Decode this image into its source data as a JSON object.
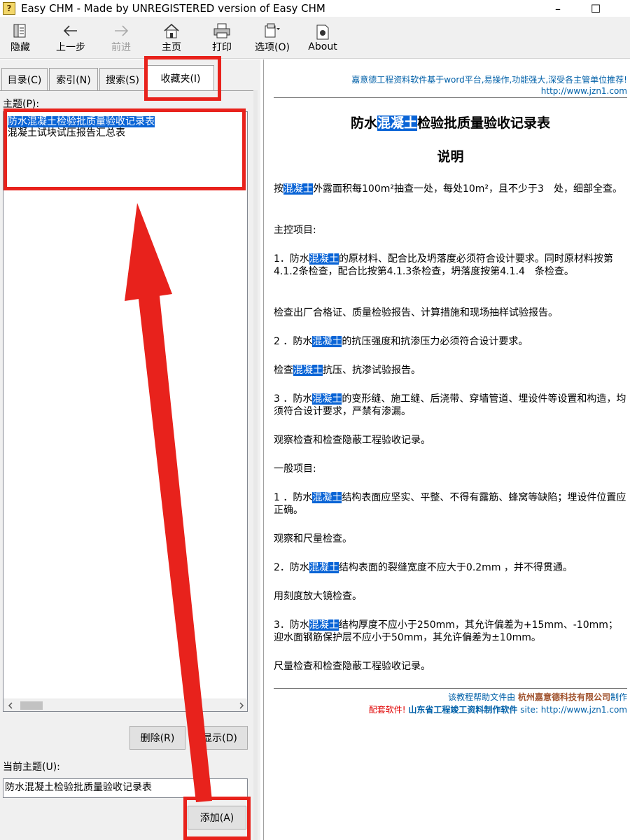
{
  "window": {
    "title": "Easy CHM - Made by UNREGISTERED version of Easy CHM",
    "icon_label": "?",
    "minimize": "–",
    "maximize": "☐"
  },
  "toolbar": {
    "items": [
      {
        "label": "隐藏",
        "icon": "hide-icon"
      },
      {
        "label": "上一步",
        "icon": "back-arrow-icon"
      },
      {
        "label": "前进",
        "icon": "forward-arrow-icon",
        "disabled": true
      },
      {
        "label": "主页",
        "icon": "home-icon"
      },
      {
        "label": "打印",
        "icon": "printer-icon"
      },
      {
        "label": "选项(O)",
        "icon": "options-icon"
      },
      {
        "label": "About",
        "icon": "about-icon"
      }
    ]
  },
  "tabs": [
    "目录(C)",
    "索引(N)",
    "搜索(S)",
    "收藏夹(I)"
  ],
  "favorites": {
    "topic_label": "主题(P):",
    "topics": [
      "防水混凝土检验批质量验收记录表",
      "混凝土试块试压报告汇总表"
    ],
    "delete_button": "删除(R)",
    "show_button": "显示(D)",
    "current_topic_label": "当前主题(U):",
    "current_topic_value": "防水混凝土检验批质量验收记录表",
    "add_button": "添加(A)"
  },
  "document": {
    "header_line1": "嘉意德工程资料软件基于word平台,易操作,功能强大,深受各主管单位推荐!",
    "header_line2": "http://www.jzn1.com",
    "title_pre": "防水",
    "title_hl": "混凝土",
    "title_post": "检验批质量验收记录表",
    "subtitle": "说明",
    "highlight": "混凝土",
    "p1_pre": "按",
    "p1_post": "外露面积每100m²抽查一处，每处10m²，且不少于3　处，细部全查。",
    "p2": "主控项目:",
    "p3_pre": "1．防水",
    "p3_post": "的原材料、配合比及坍落度必须符合设计要求。同时原材料按第4.1.2条检查，配合比按第4.1.3条检查，坍落度按第4.1.4　条检查。",
    "p4": "检查出厂合格证、质量检验报告、计算措施和现场抽样试验报告。",
    "p5_pre": "2 ．防水",
    "p5_post": "的抗压强度和抗渗压力必须符合设计要求。",
    "p6_pre": "检查",
    "p6_post": "抗压、抗渗试验报告。",
    "p7_pre": "3 ．防水",
    "p7_post": "的变形缝、施工缝、后浇带、穿墙管道、埋设件等设置和构造，均须符合设计要求，严禁有渗漏。",
    "p8": "观察检查和检查隐蔽工程验收记录。",
    "p9": "一般项目:",
    "p10_pre": "1 ．防水",
    "p10_post": "结构表面应坚实、平整、不得有露筋、蜂窝等缺陷；埋设件位置应正确。",
    "p11": "观察和尺量检查。",
    "p12_pre": "2．防水",
    "p12_post": "结构表面的裂缝宽度不应大于0.2mm ，并不得贯通。",
    "p13": "用刻度放大镜检查。",
    "p14_pre": "3．防水",
    "p14_post": "结构厚度不应小于250mm，其允许偏差为+15mm、-10mm；迎水面钢筋保护层不应小于50mm，其允许偏差为±10mm。",
    "p15": "尺量检查和检查隐蔽工程验收记录。",
    "footer1_pre": "该教程帮助文件由 ",
    "footer1_company": "杭州嘉意德科技有限公司",
    "footer1_post": "制作",
    "footer2_red": "配套软件! ",
    "footer2_bold": "山东省工程竣工资料制作软件",
    "footer2_site": " site: http://www.jzn1.com"
  },
  "colors": {
    "annotation": "#e8221c",
    "selection": "#0a64d6",
    "link": "#0060a8"
  }
}
